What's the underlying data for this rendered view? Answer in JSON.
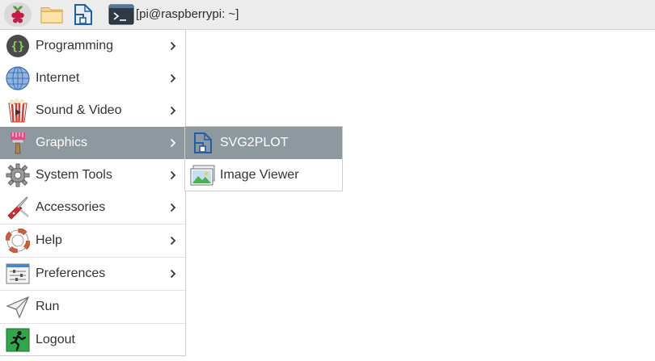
{
  "taskbar": {
    "terminal_window_title": "[pi@raspberrypi: ~]",
    "icons": [
      "raspberry-icon",
      "file-manager-icon",
      "svg2plot-icon",
      "terminal-icon"
    ]
  },
  "menu": {
    "items": [
      {
        "label": "Programming",
        "icon": "programming-icon",
        "has_submenu": true
      },
      {
        "label": "Internet",
        "icon": "internet-icon",
        "has_submenu": true
      },
      {
        "label": "Sound & Video",
        "icon": "sound-video-icon",
        "has_submenu": true
      },
      {
        "label": "Graphics",
        "icon": "graphics-icon",
        "has_submenu": true,
        "active": true
      },
      {
        "label": "System Tools",
        "icon": "system-tools-icon",
        "has_submenu": true
      },
      {
        "label": "Accessories",
        "icon": "accessories-icon",
        "has_submenu": true
      },
      {
        "label": "Help",
        "icon": "help-icon",
        "has_submenu": true
      },
      {
        "label": "Preferences",
        "icon": "preferences-icon",
        "has_submenu": true
      },
      {
        "label": "Run",
        "icon": "run-icon",
        "has_submenu": false
      },
      {
        "label": "Logout",
        "icon": "logout-icon",
        "has_submenu": false
      }
    ]
  },
  "submenu": {
    "items": [
      {
        "label": "SVG2PLOT",
        "icon": "svg2plot-icon",
        "active": true
      },
      {
        "label": "Image Viewer",
        "icon": "image-viewer-icon"
      }
    ]
  },
  "colors": {
    "highlight": "#8e989f",
    "taskbar": "#ececec",
    "menu_background": "#ffffff"
  }
}
